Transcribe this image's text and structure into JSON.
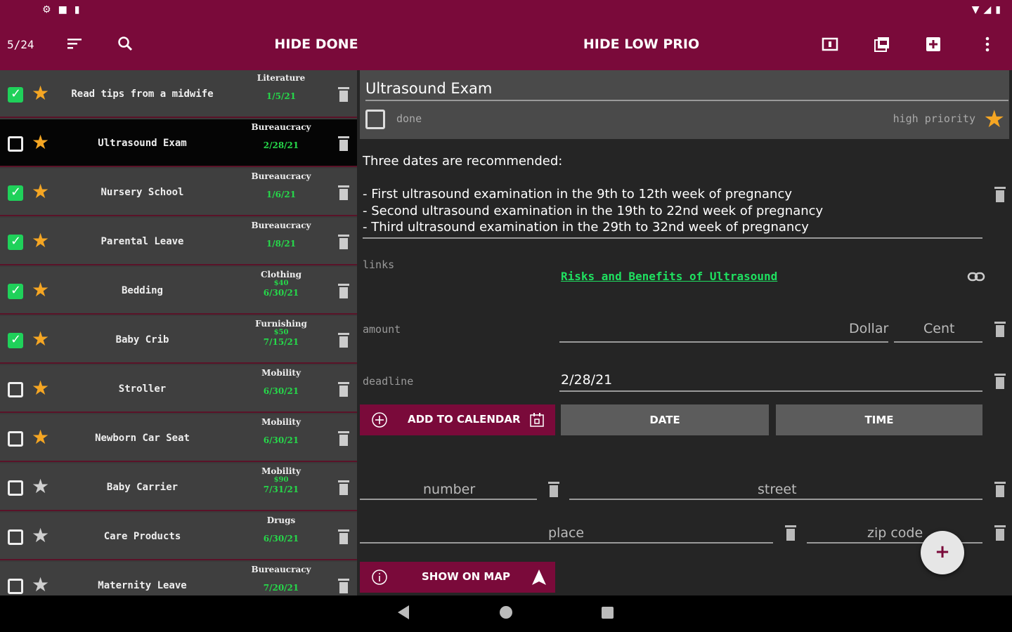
{
  "colors": {
    "primary": "#7a0a3a",
    "green": "#1fd15a",
    "star": "#f5a623"
  },
  "toolbar": {
    "counter": "5/24",
    "hide_done": "HIDE DONE",
    "hide_low_prio": "HIDE LOW PRIO"
  },
  "list": [
    {
      "title": "Read tips from a midwife",
      "category": "Literature",
      "price": "",
      "date": "1/5/21",
      "done": true,
      "selected": false,
      "starred": true
    },
    {
      "title": "Ultrasound Exam",
      "category": "Bureaucracy",
      "price": "",
      "date": "2/28/21",
      "done": false,
      "selected": true,
      "starred": true
    },
    {
      "title": "Nursery School",
      "category": "Bureaucracy",
      "price": "",
      "date": "1/6/21",
      "done": true,
      "selected": false,
      "starred": true
    },
    {
      "title": "Parental Leave",
      "category": "Bureaucracy",
      "price": "",
      "date": "1/8/21",
      "done": true,
      "selected": false,
      "starred": true
    },
    {
      "title": "Bedding",
      "category": "Clothing",
      "price": "$40",
      "date": "6/30/21",
      "done": true,
      "selected": false,
      "starred": true
    },
    {
      "title": "Baby Crib",
      "category": "Furnishing",
      "price": "$50",
      "date": "7/15/21",
      "done": true,
      "selected": false,
      "starred": true
    },
    {
      "title": "Stroller",
      "category": "Mobility",
      "price": "",
      "date": "6/30/21",
      "done": false,
      "selected": false,
      "starred": true
    },
    {
      "title": "Newborn Car Seat",
      "category": "Mobility",
      "price": "",
      "date": "6/30/21",
      "done": false,
      "selected": false,
      "starred": true
    },
    {
      "title": "Baby Carrier",
      "category": "Mobility",
      "price": "$90",
      "date": "7/31/21",
      "done": false,
      "selected": false,
      "starred": false
    },
    {
      "title": "Care Products",
      "category": "Drugs",
      "price": "",
      "date": "6/30/21",
      "done": false,
      "selected": false,
      "starred": false
    },
    {
      "title": "Maternity Leave",
      "category": "Bureaucracy",
      "price": "",
      "date": "7/20/21",
      "done": false,
      "selected": false,
      "starred": false
    }
  ],
  "detail": {
    "title": "Ultrasound Exam",
    "done_label": "done",
    "priority_label": "high priority",
    "description": [
      "Three dates are recommended:",
      "",
      "- First ultrasound examination in the 9th to 12th week of pregnancy",
      "- Second ultrasound examination in the 19th to 22nd week of pregnancy",
      "- Third ultrasound examination in the 29th to 32nd week of pregnancy"
    ],
    "links_label": "links",
    "link_text": "Risks and Benefits of Ultrasound",
    "amount_label": "amount",
    "dollar_placeholder": "Dollar",
    "cent_placeholder": "Cent",
    "deadline_label": "deadline",
    "deadline_value": "2/28/21",
    "add_to_calendar": "ADD TO CALENDAR",
    "date_button": "DATE",
    "time_button": "TIME",
    "number_placeholder": "number",
    "street_placeholder": "street",
    "place_placeholder": "place",
    "zip_placeholder": "zip code",
    "show_on_map": "SHOW ON MAP",
    "fab": "+"
  }
}
